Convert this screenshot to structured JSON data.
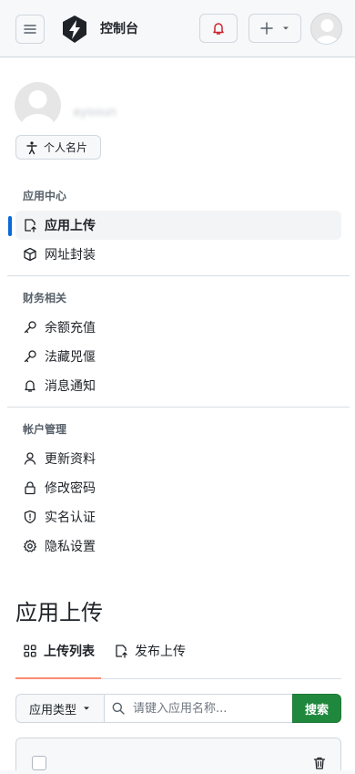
{
  "header": {
    "app_title": "控制台",
    "icons": [
      "menu-icon",
      "lightning-logo-icon",
      "bell-icon",
      "plus-icon",
      "caret-down-icon",
      "avatar-icon"
    ]
  },
  "profile": {
    "username": "ayooun",
    "card_button_label": "个人名片"
  },
  "sidebar": {
    "sections": [
      {
        "title": "应用中心",
        "items": [
          {
            "label": "应用上传",
            "icon": "upload-file-icon",
            "active": true
          },
          {
            "label": "网址封装",
            "icon": "package-icon",
            "active": false
          }
        ]
      },
      {
        "title": "财务相关",
        "items": [
          {
            "label": "余额充值",
            "icon": "key-icon",
            "active": false
          },
          {
            "label": "法藏兕偃",
            "icon": "key-icon",
            "active": false
          },
          {
            "label": "消息通知",
            "icon": "bell-icon",
            "active": false
          }
        ]
      },
      {
        "title": "帐户管理",
        "items": [
          {
            "label": "更新资料",
            "icon": "person-icon",
            "active": false
          },
          {
            "label": "修改密码",
            "icon": "lock-icon",
            "active": false
          },
          {
            "label": "实名认证",
            "icon": "shield-icon",
            "active": false
          },
          {
            "label": "隐私设置",
            "icon": "gear-icon",
            "active": false
          }
        ]
      }
    ]
  },
  "main": {
    "heading": "应用上传",
    "tabs": [
      {
        "label": "上传列表",
        "icon": "grid-icon",
        "active": true
      },
      {
        "label": "发布上传",
        "icon": "upload-file-icon",
        "active": false
      }
    ],
    "filter": {
      "type_select_label": "应用类型",
      "search_placeholder": "请键入应用名称...",
      "search_button_label": "搜索"
    }
  },
  "colors": {
    "accent": "#0969da",
    "tab_underline": "#fd8c73",
    "primary_button": "#1f883d",
    "bell": "#cf222e"
  }
}
